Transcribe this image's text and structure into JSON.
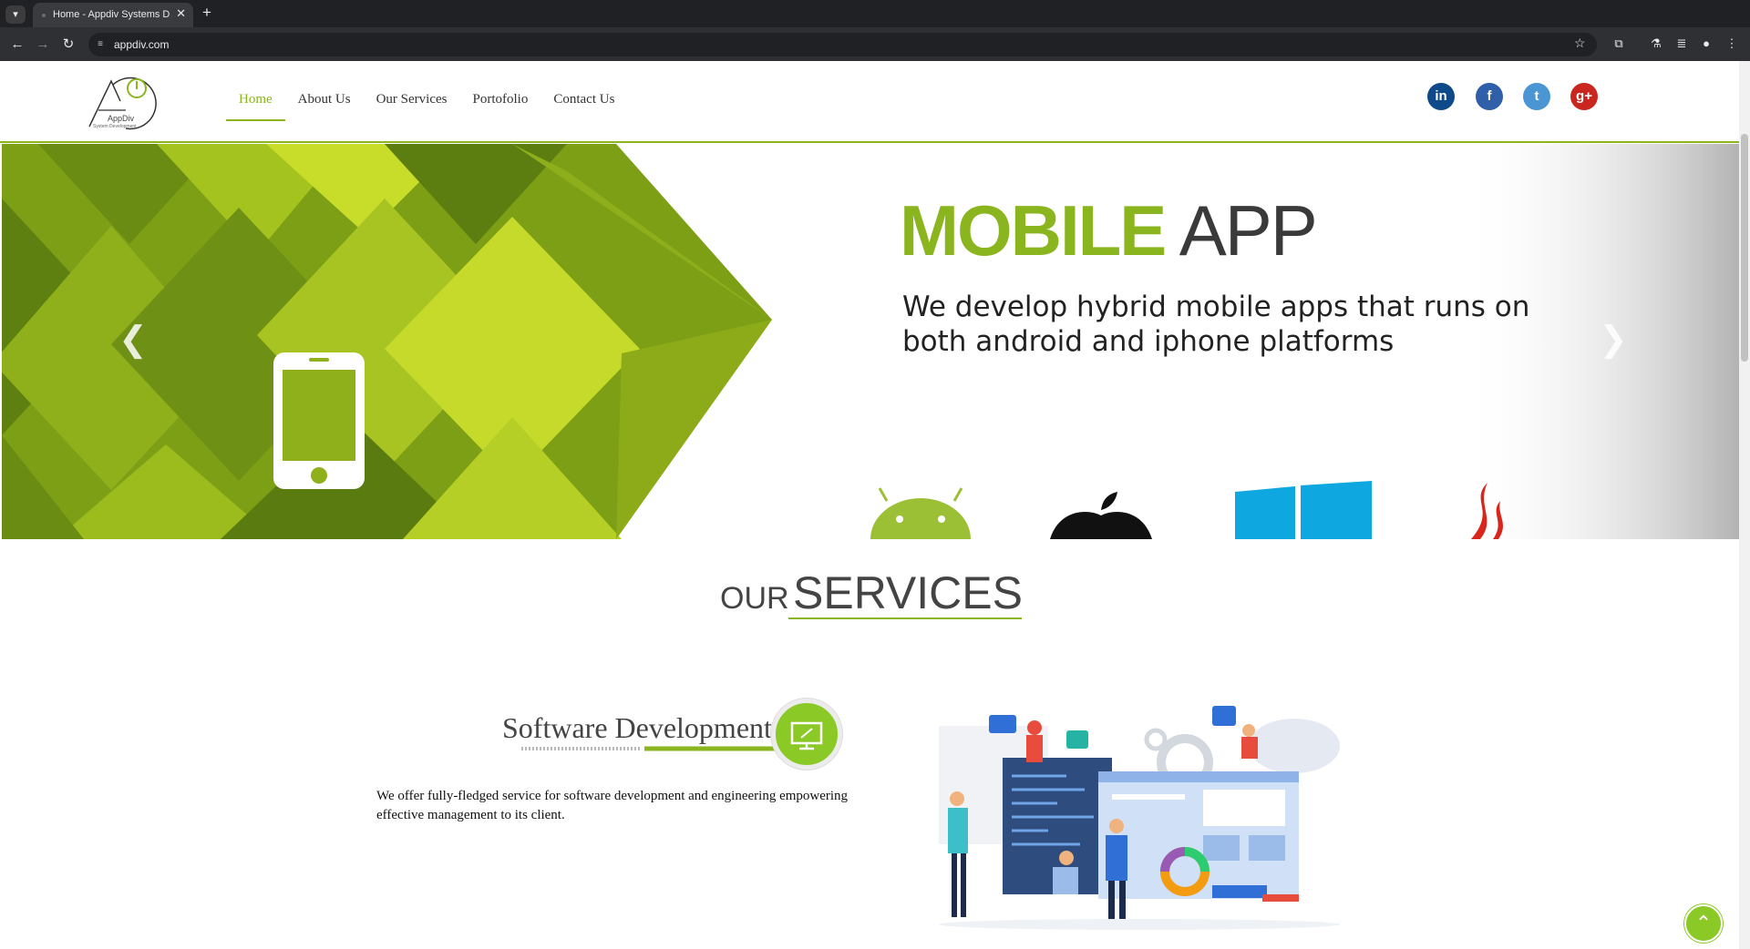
{
  "browser": {
    "tab_title": "Home - Appdiv Systems D",
    "url": "appdiv.com"
  },
  "site": {
    "logo_name": "AppDiv",
    "logo_tagline": "System Development",
    "nav": [
      {
        "label": "Home"
      },
      {
        "label": "About Us"
      },
      {
        "label": "Our Services"
      },
      {
        "label": "Portofolio"
      },
      {
        "label": "Contact Us"
      }
    ],
    "social": [
      {
        "icon": "linkedin-icon",
        "glyph": "in",
        "color": "#0e4a8a"
      },
      {
        "icon": "facebook-icon",
        "glyph": "f",
        "color": "#2f5fa8"
      },
      {
        "icon": "twitter-icon",
        "glyph": "t",
        "color": "#4a96d4"
      },
      {
        "icon": "google-plus-icon",
        "glyph": "g+",
        "color": "#c9261f"
      }
    ]
  },
  "slider": {
    "title_bold": "MOBILE",
    "title_normal": " APP",
    "text": "We develop hybrid mobile apps that runs on both android and iphone platforms",
    "platform_icons": [
      "android-icon",
      "apple-icon",
      "windows-icon",
      "java-icon"
    ]
  },
  "services": {
    "heading_small": "OUR",
    "heading_large": "SERVICES",
    "items": [
      {
        "title": "Software Development",
        "description": "We offer fully-fledged service for software development and engineering empowering effective management to its client."
      }
    ]
  },
  "colors": {
    "accent": "#8ab51e",
    "badge": "#8ac926"
  }
}
